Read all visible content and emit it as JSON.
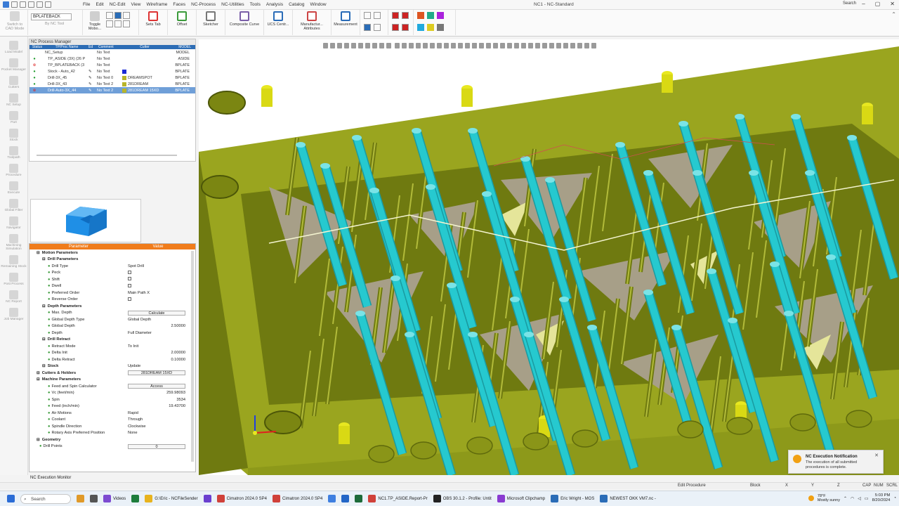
{
  "window": {
    "app_title": "NC1 - NC-Standard",
    "search_label": "Search",
    "menu": [
      "File",
      "Edit",
      "NC-Edit",
      "View",
      "Wireframe",
      "Faces",
      "NC-Process",
      "NC-Utilities",
      "Tools",
      "Analysis",
      "Catalog",
      "Window"
    ]
  },
  "ribbon": {
    "switch_cad_label": "Switch to CAD Mode",
    "procedure_dropdown": "BPLATEBACK",
    "by_nc_tool_label": "By NC Tool",
    "toggle_label": "Toggle Mobo...",
    "buttons": [
      {
        "label": "Sets Tab",
        "color": "#d33"
      },
      {
        "label": "Offset",
        "color": "#3a9a3a"
      },
      {
        "label": "Sketcher",
        "color": "#777"
      },
      {
        "label": "Composite Curve",
        "color": "#7a5fa8"
      },
      {
        "label": "UCS Centr...",
        "color": "#2a6cb7"
      },
      {
        "label": "Manufactur... Attributes",
        "color": "#c44"
      },
      {
        "label": "Measurement",
        "color": "#2a6cb7"
      }
    ]
  },
  "left_icons": [
    "Load Model",
    "Pocket Manager",
    "Cutters",
    "NC Setup",
    "Part",
    "Stock",
    "Toolpath",
    "Procedure",
    "Execute",
    "Global Filter",
    "Navigator",
    "Machining Simulation",
    "Remaining Stock",
    "Post Process",
    "NC Report",
    "Job Manager"
  ],
  "process_manager": {
    "title": "NC Process Manager",
    "columns": [
      "Status",
      "TP/Proc Name",
      "Ed",
      "Comment",
      "Cutter",
      "MODEL"
    ],
    "rows": [
      {
        "status": "",
        "name": "NC_Setup",
        "lock": "",
        "comment": "No Text",
        "cutter": "",
        "cutter_color": "",
        "model": "MODEL",
        "selected": false
      },
      {
        "status": "ok",
        "name": "TP_ASIDE (3X) (26 P",
        "lock": "",
        "comment": "No Text",
        "cutter": "",
        "cutter_color": "",
        "model": "ASIDE",
        "selected": false
      },
      {
        "status": "bad",
        "name": "TP_BPLATEBACK (3",
        "lock": "",
        "comment": "No Text",
        "cutter": "",
        "cutter_color": "",
        "model": "BPLATE",
        "selected": false
      },
      {
        "status": "ok",
        "name": "Stock - Auto_42",
        "lock": "✎",
        "comment": "No Text",
        "cutter": "",
        "cutter_color": "#1b2bd6",
        "model": "BPLATE",
        "selected": false
      },
      {
        "status": "ok",
        "name": "Drill-3X_45",
        "lock": "✎",
        "comment": "No Text  0",
        "cutter": "DREAMSPOT",
        "cutter_color": "#b8b52a",
        "model": "BPLATE",
        "selected": false
      },
      {
        "status": "ok",
        "name": "Drill-3X_43",
        "lock": "✎",
        "comment": "No Text  2",
        "cutter": "281DREAM",
        "cutter_color": "#b8b52a",
        "model": "BPLATE",
        "selected": false
      },
      {
        "status": "bad",
        "name": "Drill-Auto-3X_44",
        "lock": "✎",
        "comment": "No Text  2",
        "cutter": "281DREAM 15XD",
        "cutter_color": "#b8b52a",
        "model": "BPLATE",
        "selected": true
      }
    ]
  },
  "parameters": {
    "header_param": "Parameter",
    "header_value": "Value",
    "rows": [
      {
        "kind": "sec",
        "key": "Motion Parameters",
        "value": "",
        "vtype": "text"
      },
      {
        "kind": "grp",
        "key": "Drill Parameters",
        "value": "",
        "vtype": "text"
      },
      {
        "kind": "leaf",
        "key": "Drill Type",
        "value": "Spot Drill",
        "vtype": "text"
      },
      {
        "kind": "leaf",
        "key": "Peck",
        "value": "",
        "vtype": "check"
      },
      {
        "kind": "leaf",
        "key": "Shift",
        "value": "",
        "vtype": "check"
      },
      {
        "kind": "leaf",
        "key": "Dwell",
        "value": "",
        "vtype": "check"
      },
      {
        "kind": "leaf",
        "key": "Preferred Order",
        "value": "Main Path X",
        "vtype": "text"
      },
      {
        "kind": "leaf",
        "key": "Reverse Order",
        "value": "",
        "vtype": "check"
      },
      {
        "kind": "grp",
        "key": "Depth Parameters",
        "value": "",
        "vtype": "text"
      },
      {
        "kind": "leaf",
        "key": "Max. Depth",
        "value": "Calculate",
        "vtype": "button"
      },
      {
        "kind": "leaf",
        "key": "Global Depth Type",
        "value": "Global Depth",
        "vtype": "text"
      },
      {
        "kind": "leaf",
        "key": "Global Depth",
        "value": "2.50000",
        "vtype": "num"
      },
      {
        "kind": "leaf",
        "key": "Depth",
        "value": "Full Diameter",
        "vtype": "text"
      },
      {
        "kind": "grp",
        "key": "Drill Retract",
        "value": "",
        "vtype": "text"
      },
      {
        "kind": "leaf",
        "key": "Retract Mode",
        "value": "To Init",
        "vtype": "text"
      },
      {
        "kind": "leaf",
        "key": "Delta Init",
        "value": "2.00000",
        "vtype": "num"
      },
      {
        "kind": "leaf",
        "key": "Delta Retract",
        "value": "0.10000",
        "vtype": "num"
      },
      {
        "kind": "grp",
        "key": "Stock",
        "value": "Update",
        "vtype": "text"
      },
      {
        "kind": "sec",
        "key": "Cutters & Holders",
        "value": "281DREAM 15XD",
        "vtype": "button"
      },
      {
        "kind": "sec",
        "key": "Machine Parameters",
        "value": "",
        "vtype": "text"
      },
      {
        "kind": "leaf",
        "key": "Feed and Spin Calculator",
        "value": "Access",
        "vtype": "button"
      },
      {
        "kind": "leaf",
        "key": "Vc (feet/min)",
        "value": "259.98093",
        "vtype": "num"
      },
      {
        "kind": "leaf",
        "key": "Spin",
        "value": "3534",
        "vtype": "num"
      },
      {
        "kind": "leaf",
        "key": "Feed (inch/min)",
        "value": "19.43700",
        "vtype": "num"
      },
      {
        "kind": "leaf",
        "key": "Air Motions",
        "value": "Rapid",
        "vtype": "text"
      },
      {
        "kind": "leaf",
        "key": "Coolant",
        "value": "Through",
        "vtype": "text"
      },
      {
        "kind": "leaf",
        "key": "Spindle Direction",
        "value": "Clockwise",
        "vtype": "text"
      },
      {
        "kind": "leaf",
        "key": "Rotary Axis Preferred Position",
        "value": "None",
        "vtype": "text"
      },
      {
        "kind": "sec",
        "key": "Geometry",
        "value": "",
        "vtype": "text"
      },
      {
        "kind": "sub",
        "key": "Drill Points",
        "value": "0",
        "vtype": "button"
      }
    ]
  },
  "exec_monitor": "NC Execution Monitor",
  "notification": {
    "title": "NC Execution Notification",
    "body": "The execution of all submitted procedures is complete."
  },
  "status": {
    "mode": "Edit Procedure",
    "block": "Block",
    "x": "X",
    "y": "Y",
    "z": "Z",
    "cap": "CAP",
    "num": "NUM",
    "scrl": "SCRL"
  },
  "taskbar": {
    "search": "Search",
    "items": [
      {
        "label": "Videos",
        "color": "#7d4bd1"
      },
      {
        "label": "",
        "color": "#1e7d3c"
      },
      {
        "label": "G:\\Eric - NCFileSender",
        "color": "#e8b31e"
      },
      {
        "label": "",
        "color": "#6a3fcf"
      },
      {
        "label": "Cimatron 2024.0  SP4",
        "color": "#d0413a"
      },
      {
        "label": "Cimatron 2024.0  SP4",
        "color": "#d0413a"
      },
      {
        "label": "",
        "color": "#3f7fe0"
      },
      {
        "label": "",
        "color": "#2366c7"
      },
      {
        "label": "",
        "color": "#1d6b3a"
      },
      {
        "label": "NC1.TP_ASIDE.Report-Pr",
        "color": "#d0413a"
      },
      {
        "label": "OBS 30.1.2 - Profile: Untit",
        "color": "#222"
      },
      {
        "label": "Microsoft Clipchamp",
        "color": "#8a3bd1"
      },
      {
        "label": "Eric Wright - MOS",
        "color": "#2a6cb7"
      },
      {
        "label": "NEWEST OKK VM7.nc -",
        "color": "#2a6cb7"
      }
    ],
    "weather_temp": "78°F",
    "weather_text": "Mostly sunny",
    "time": "5:03 PM",
    "date": "8/20/2024"
  },
  "viewport": {
    "plate_color": "#9aa51f",
    "plate_dark": "#6f7a10",
    "tube_color": "#26c9cf",
    "pin_color": "#e8e820",
    "cavity_color": "#a79f88"
  }
}
